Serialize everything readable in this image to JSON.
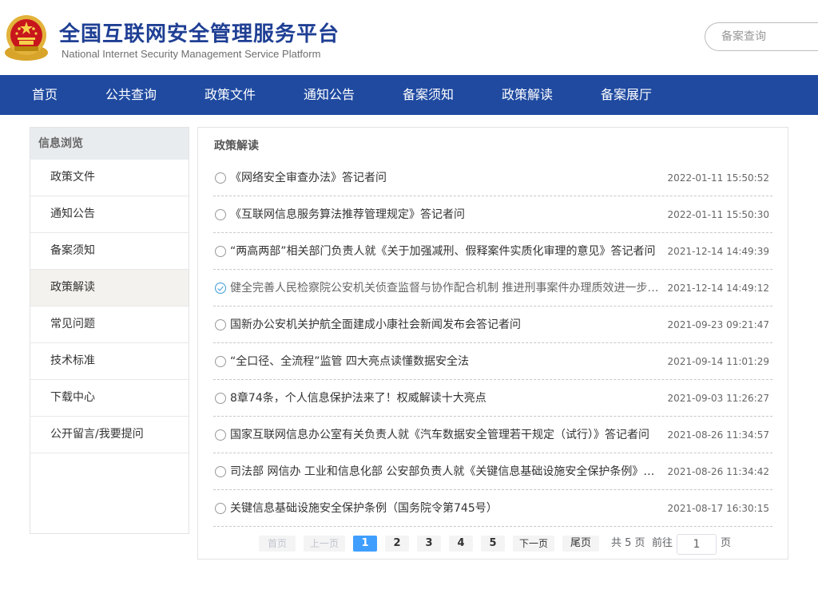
{
  "header": {
    "title": "全国互联网安全管理服务平台",
    "subtitle": "National Internet Security Management Service Platform",
    "search_placeholder": "备案查询"
  },
  "nav": {
    "items": [
      {
        "label": "首页"
      },
      {
        "label": "公共查询"
      },
      {
        "label": "政策文件"
      },
      {
        "label": "通知公告"
      },
      {
        "label": "备案须知"
      },
      {
        "label": "政策解读"
      },
      {
        "label": "备案展厅"
      }
    ]
  },
  "sidebar": {
    "heading": "信息浏览",
    "items": [
      {
        "label": "政策文件"
      },
      {
        "label": "通知公告"
      },
      {
        "label": "备案须知"
      },
      {
        "label": "政策解读"
      },
      {
        "label": "常见问题"
      },
      {
        "label": "技术标准"
      },
      {
        "label": "下载中心"
      },
      {
        "label": "公开留言/我要提问"
      }
    ],
    "active_index": 3
  },
  "main": {
    "title": "政策解读",
    "items": [
      {
        "title": "《网络安全审查办法》答记者问",
        "date": "2022-01-11 15:50:52"
      },
      {
        "title": "《互联网信息服务算法推荐管理规定》答记者问",
        "date": "2022-01-11 15:50:30"
      },
      {
        "title": "“两高两部”相关部门负责人就《关于加强减刑、假释案件实质化审理的意见》答记者问",
        "date": "2021-12-14 14:49:39"
      },
      {
        "title": "健全完善人民检察院公安机关侦查监督与协作配合机制 推进刑事案件办理质效进一步提升",
        "date": "2021-12-14 14:49:12"
      },
      {
        "title": "国新办公安机关护航全面建成小康社会新闻发布会答记者问",
        "date": "2021-09-23 09:21:47"
      },
      {
        "title": "“全口径、全流程”监管 四大亮点读懂数据安全法",
        "date": "2021-09-14 11:01:29"
      },
      {
        "title": "8章74条，个人信息保护法来了！权威解读十大亮点",
        "date": "2021-09-03 11:26:27"
      },
      {
        "title": "国家互联网信息办公室有关负责人就《汽车数据安全管理若干规定（试行）》答记者问",
        "date": "2021-08-26 11:34:57"
      },
      {
        "title": "司法部 网信办 工业和信息化部 公安部负责人就《关键信息基础设施安全保护条例》答记者问",
        "date": "2021-08-26 11:34:42"
      },
      {
        "title": "关键信息基础设施安全保护条例（国务院令第745号）",
        "date": "2021-08-17 16:30:15"
      }
    ],
    "visited_index": 3
  },
  "pagination": {
    "first": "首页",
    "prev": "上一页",
    "pages": [
      "1",
      "2",
      "3",
      "4",
      "5"
    ],
    "current": "1",
    "next": "下一页",
    "last": "尾页",
    "total": "共 5 页",
    "goto_label": "前往",
    "goto_value": "1",
    "page_suffix": "页"
  },
  "colors": {
    "nav_bg": "#1f4aa0",
    "title_blue": "#1f3f94",
    "active_page": "#409eff"
  },
  "icons": {
    "emblem": "national-emblem-icon",
    "list_bullet": "radio-circle-icon",
    "visited_bullet": "check-circle-icon"
  }
}
